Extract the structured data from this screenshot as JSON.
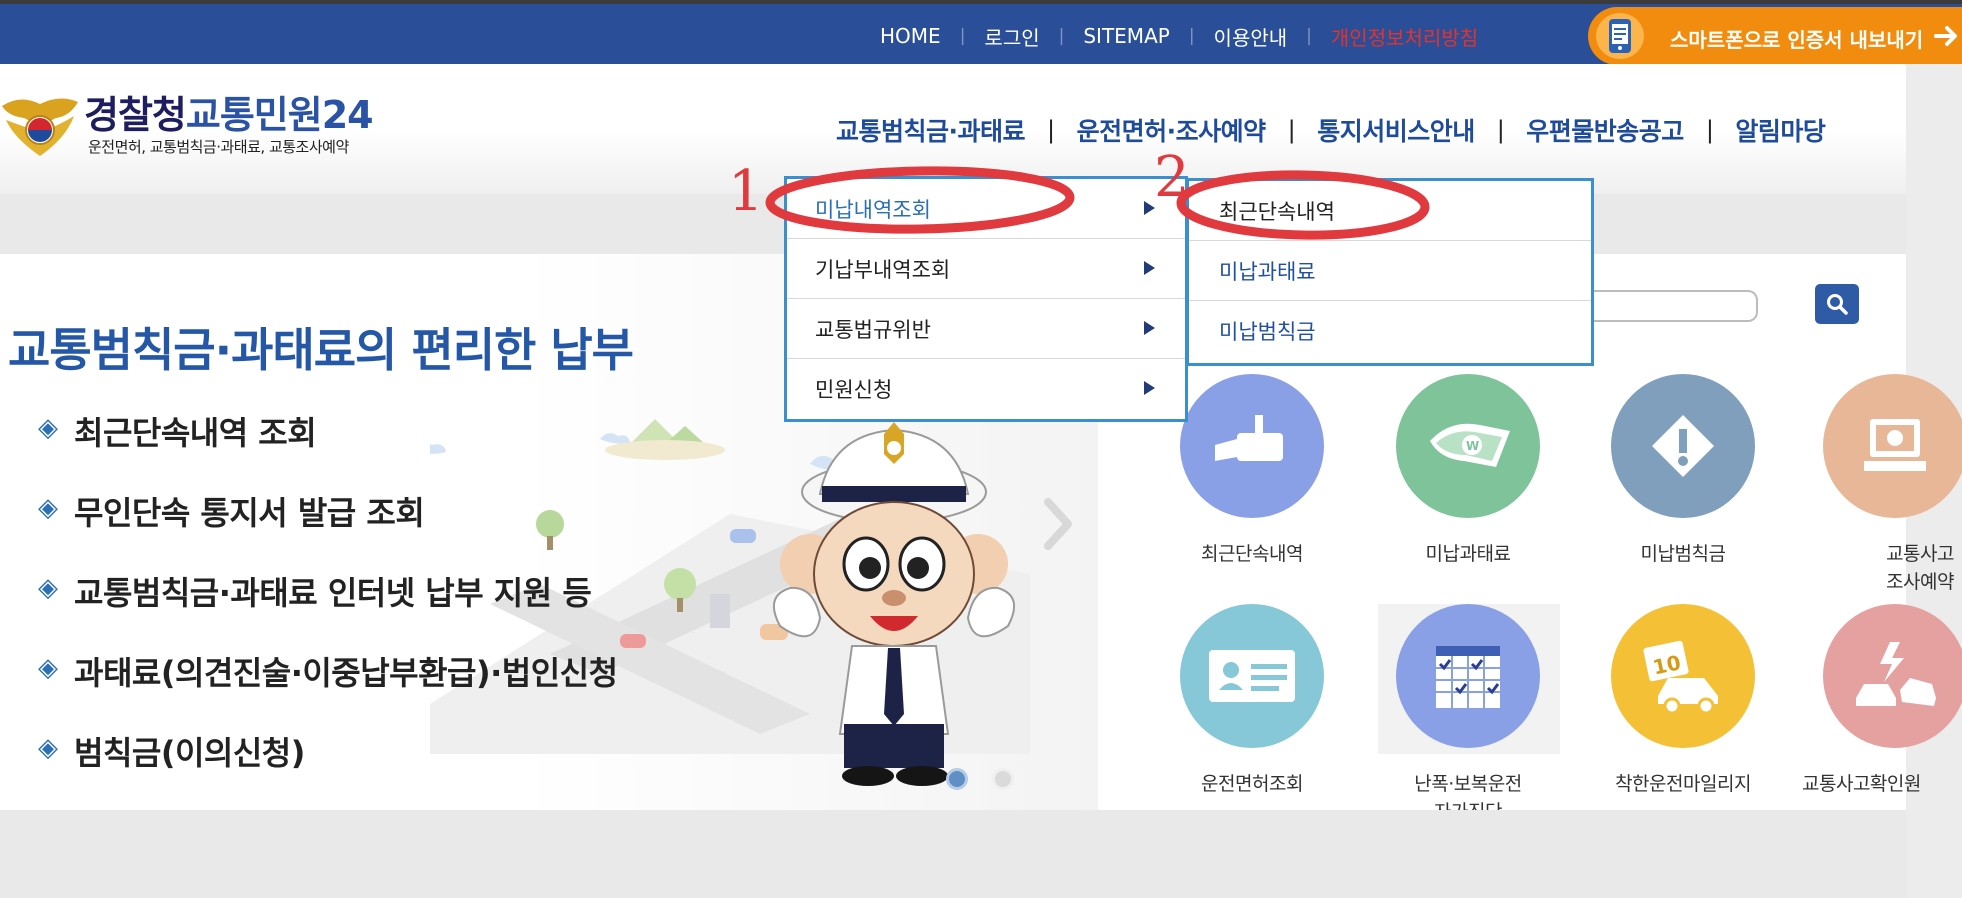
{
  "topbar": {
    "links": [
      "HOME",
      "로그인",
      "SITEMAP",
      "이용안내"
    ],
    "privacy_link": "개인정보처리방침",
    "smartphone_button": "스마트폰으로 인증서 내보내기",
    "colors": {
      "bar": "#2a4e97",
      "privacy": "#e5322d",
      "button": "#f28c0e"
    }
  },
  "header": {
    "logo_main": "경찰청",
    "logo_sub": "교통민원24",
    "logo_tagline": "운전면허, 교통범칙금·과태료, 교통조사예약"
  },
  "mainnav": {
    "items": [
      "교통범칙금·과태료",
      "운전면허·조사예약",
      "통지서비스안내",
      "우편물반송공고",
      "알림마당"
    ]
  },
  "dropdown": {
    "level1": [
      {
        "label": "미납내역조회",
        "active": true
      },
      {
        "label": "기납부내역조회",
        "active": false
      },
      {
        "label": "교통법규위반",
        "active": false
      },
      {
        "label": "민원신청",
        "active": false
      }
    ],
    "level2": [
      {
        "label": "최근단속내역",
        "active": true
      },
      {
        "label": "미납과태료",
        "active": false
      },
      {
        "label": "미납범칙금",
        "active": false
      }
    ]
  },
  "annotations": {
    "mark1": "1",
    "mark2": "2",
    "color": "#e03a3e"
  },
  "hero": {
    "title": "교통범칙금·과태료의 편리한 납부",
    "bullets": [
      "최근단속내역 조회",
      "무인단속 통지서 발급 조회",
      "교통범칙금·과태료 인터넷 납부 지원 등",
      "과태료(의견진술·이중납부환급)·법인신청",
      "범칙금(이의신청)"
    ],
    "bullet_icon": "diamond-bullet-icon",
    "slides": {
      "count": 2,
      "active": 1
    }
  },
  "services": [
    {
      "label": "최근단속내역",
      "icon": "camera-icon",
      "color": "#8aa0e6"
    },
    {
      "label": "미납과태료",
      "icon": "money-icon",
      "color": "#7ec39a"
    },
    {
      "label": "미납범칙금",
      "icon": "warning-icon",
      "color": "#7f9fbd"
    },
    {
      "label": "교통사고\n조사예약",
      "icon": "monitor-icon",
      "color": "#e8b798"
    },
    {
      "label": "운전면허조회",
      "icon": "license-card-icon",
      "color": "#86c8d7"
    },
    {
      "label": "난폭·보복운전\n자가진단\n체크리스트",
      "icon": "checklist-icon",
      "color": "#8aa0e6"
    },
    {
      "label": "착한운전마일리지",
      "icon": "mileage-car-icon",
      "color": "#f3c036"
    },
    {
      "label": "교통사고확인원",
      "icon": "car-crash-icon",
      "color": "#e5a0a0"
    }
  ]
}
